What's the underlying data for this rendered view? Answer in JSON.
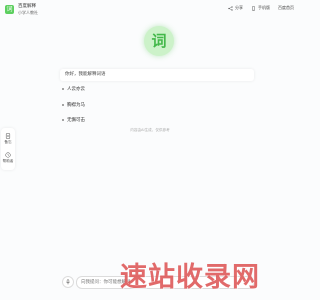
{
  "brand": {
    "logo_glyph": "词",
    "name": "百度解释",
    "subtitle": "小学人教社"
  },
  "top_actions": [
    {
      "label": "分享",
      "icon": "share-icon"
    },
    {
      "label": "手机版",
      "icon": "phone-icon"
    },
    {
      "label": "百度首页"
    }
  ],
  "hero": {
    "glyph": "词"
  },
  "prompt": {
    "text": "你好，我能解释词语"
  },
  "suggestions": [
    "人云亦云",
    "胸襟为马",
    "无懈可击"
  ],
  "hint": "内容由AI生成，仅供参考",
  "left_tools": [
    {
      "label": "备忘",
      "icon": "note-icon"
    },
    {
      "label": "帮助者",
      "icon": "clock-icon"
    }
  ],
  "input": {
    "placeholder": "向我提问：你可能想解释",
    "mic_icon": "mic-icon"
  },
  "watermark": "速站收录网",
  "colors": {
    "accent": "#5ccf5f",
    "hero_bg": "#ccf2c9",
    "hero_text": "#43b84a",
    "watermark": "#dc5050"
  }
}
